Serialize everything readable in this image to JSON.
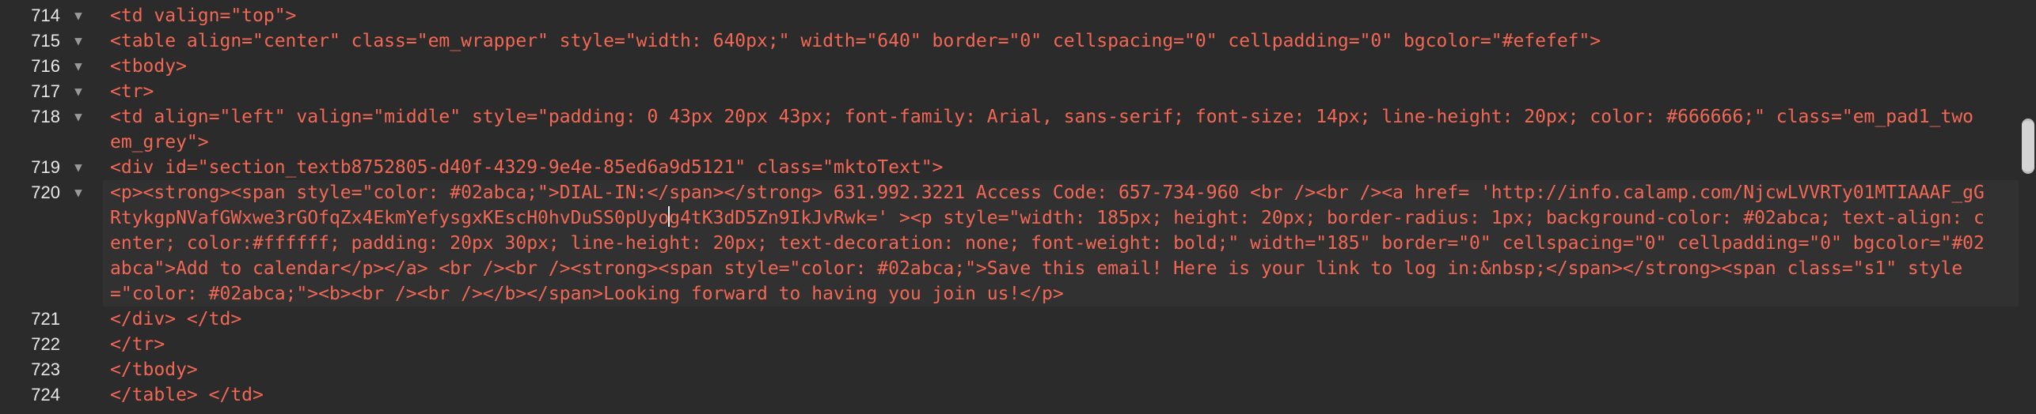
{
  "editor": {
    "lines": [
      {
        "number": "714",
        "code": "<td valign=\"top\">"
      },
      {
        "number": "715",
        "code": "<table align=\"center\" class=\"em_wrapper\" style=\"width: 640px;\" width=\"640\" border=\"0\" cellspacing=\"0\" cellpadding=\"0\" bgcolor=\"#efefef\">"
      },
      {
        "number": "716",
        "code": "<tbody>"
      },
      {
        "number": "717",
        "code": "<tr>"
      },
      {
        "number": "718",
        "code": "<td align=\"left\" valign=\"middle\" style=\"padding: 0 43px 20px 43px; font-family: Arial, sans-serif; font-size: 14px; line-height: 20px; color: #666666;\" class=\"em_pad1_two em_grey\">"
      },
      {
        "number": "719",
        "code": "<div id=\"section_textb8752805-d40f-4329-9e4e-85ed6a9d5121\" class=\"mktoText\">"
      },
      {
        "number": "720",
        "code_before_caret": "<p><strong><span style=\"color: #02abca;\">DIAL-IN:</span></strong> 631.992.3221 Access Code: 657-734-960 <br /><br /><a href= 'http://info.calamp.com/NjcwLVVRTy01MTIAAAF_gGRtykgpNVafGWxwe3rGOfqZx4EkmYefysgxKEscH0hvDuSS0pUyo",
        "code_after_caret": "g4tK3dD5Zn9IkJvRwk=' ><p style=\"width: 185px; height: 20px; border-radius: 1px; background-color: #02abca; text-align: center; color:#ffffff; padding: 20px 30px; line-height: 20px; text-decoration: none; font-weight: bold;\" width=\"185\" border=\"0\" cellspacing=\"0\" cellpadding=\"0\" bgcolor=\"#02abca\">Add to calendar</p></a> <br /><br /><strong><span style=\"color: #02abca;\">Save this email! Here is your link to log in:&nbsp;</span></strong><span class=\"s1\" style=\"color: #02abca;\"><b><br /><br /></b></span>Looking forward to having you join us!</p>"
      },
      {
        "number": "721",
        "code": "</div> </td>"
      },
      {
        "number": "722",
        "code": "</tr>"
      },
      {
        "number": "723",
        "code": "</tbody>"
      },
      {
        "number": "724",
        "code": "</table> </td>"
      }
    ]
  },
  "colors": {
    "background": "#2b2b2b",
    "active_line": "#313131",
    "tag": "#f26855",
    "attribute": "#e6c07b",
    "string": "#a6d14d"
  },
  "icons": {
    "fold": "fold-arrow-icon"
  }
}
